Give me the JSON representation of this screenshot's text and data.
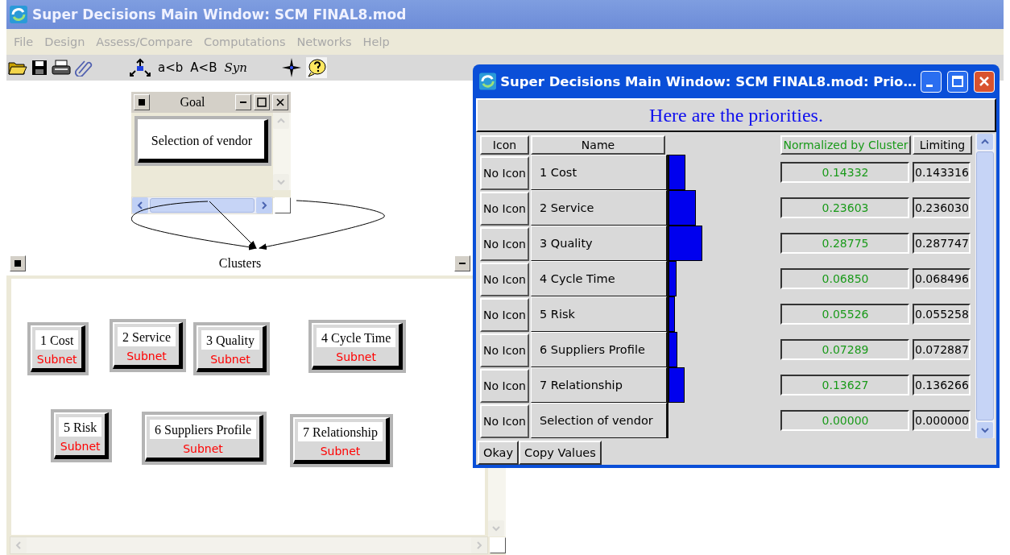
{
  "main_window": {
    "title": "Super Decisions Main Window: SCM FINAL8.mod",
    "menu": [
      "File",
      "Design",
      "Assess/Compare",
      "Computations",
      "Networks",
      "Help"
    ],
    "toolbar": {
      "text_buttons": [
        "a<b",
        "A<B",
        "Syn"
      ],
      "help_pressed": true
    }
  },
  "goal_window": {
    "title": "Goal",
    "node": "Selection of vendor"
  },
  "clusters_window": {
    "title": "Clusters",
    "clusters": [
      {
        "name": "1 Cost",
        "label": "Subnet"
      },
      {
        "name": "2 Service",
        "label": "Subnet"
      },
      {
        "name": "3 Quality",
        "label": "Subnet"
      },
      {
        "name": "4 Cycle Time",
        "label": "Subnet"
      },
      {
        "name": "5 Risk",
        "label": "Subnet"
      },
      {
        "name": "6 Suppliers Profile",
        "label": "Subnet"
      },
      {
        "name": "7 Relationship",
        "label": "Subnet"
      }
    ]
  },
  "priorities_dialog": {
    "title": "Super Decisions Main Window: SCM FINAL8.mod: Prio…",
    "heading": "Here are the priorities.",
    "columns": [
      "Icon",
      "Name",
      "Normalized by Cluster",
      "Limiting"
    ],
    "rows": [
      {
        "icon": "No Icon",
        "name": "1 Cost",
        "level": 0.14332,
        "normalized": "0.14332",
        "limiting": "0.143316"
      },
      {
        "icon": "No Icon",
        "name": "2 Service",
        "level": 0.23603,
        "normalized": "0.23603",
        "limiting": "0.236030"
      },
      {
        "icon": "No Icon",
        "name": "3 Quality",
        "level": 0.28775,
        "normalized": "0.28775",
        "limiting": "0.287747"
      },
      {
        "icon": "No Icon",
        "name": "4 Cycle Time",
        "level": 0.0685,
        "normalized": "0.06850",
        "limiting": "0.068496"
      },
      {
        "icon": "No Icon",
        "name": "5 Risk",
        "level": 0.05526,
        "normalized": "0.05526",
        "limiting": "0.055258"
      },
      {
        "icon": "No Icon",
        "name": "6 Suppliers Profile",
        "level": 0.07289,
        "normalized": "0.07289",
        "limiting": "0.072887"
      },
      {
        "icon": "No Icon",
        "name": "7 Relationship",
        "level": 0.13627,
        "normalized": "0.13627",
        "limiting": "0.136266"
      },
      {
        "icon": "No Icon",
        "name": "Selection of vendor",
        "normalized": "0.00000",
        "limiting": "0.000000"
      }
    ],
    "buttons": [
      "Okay",
      "Copy Values"
    ]
  }
}
